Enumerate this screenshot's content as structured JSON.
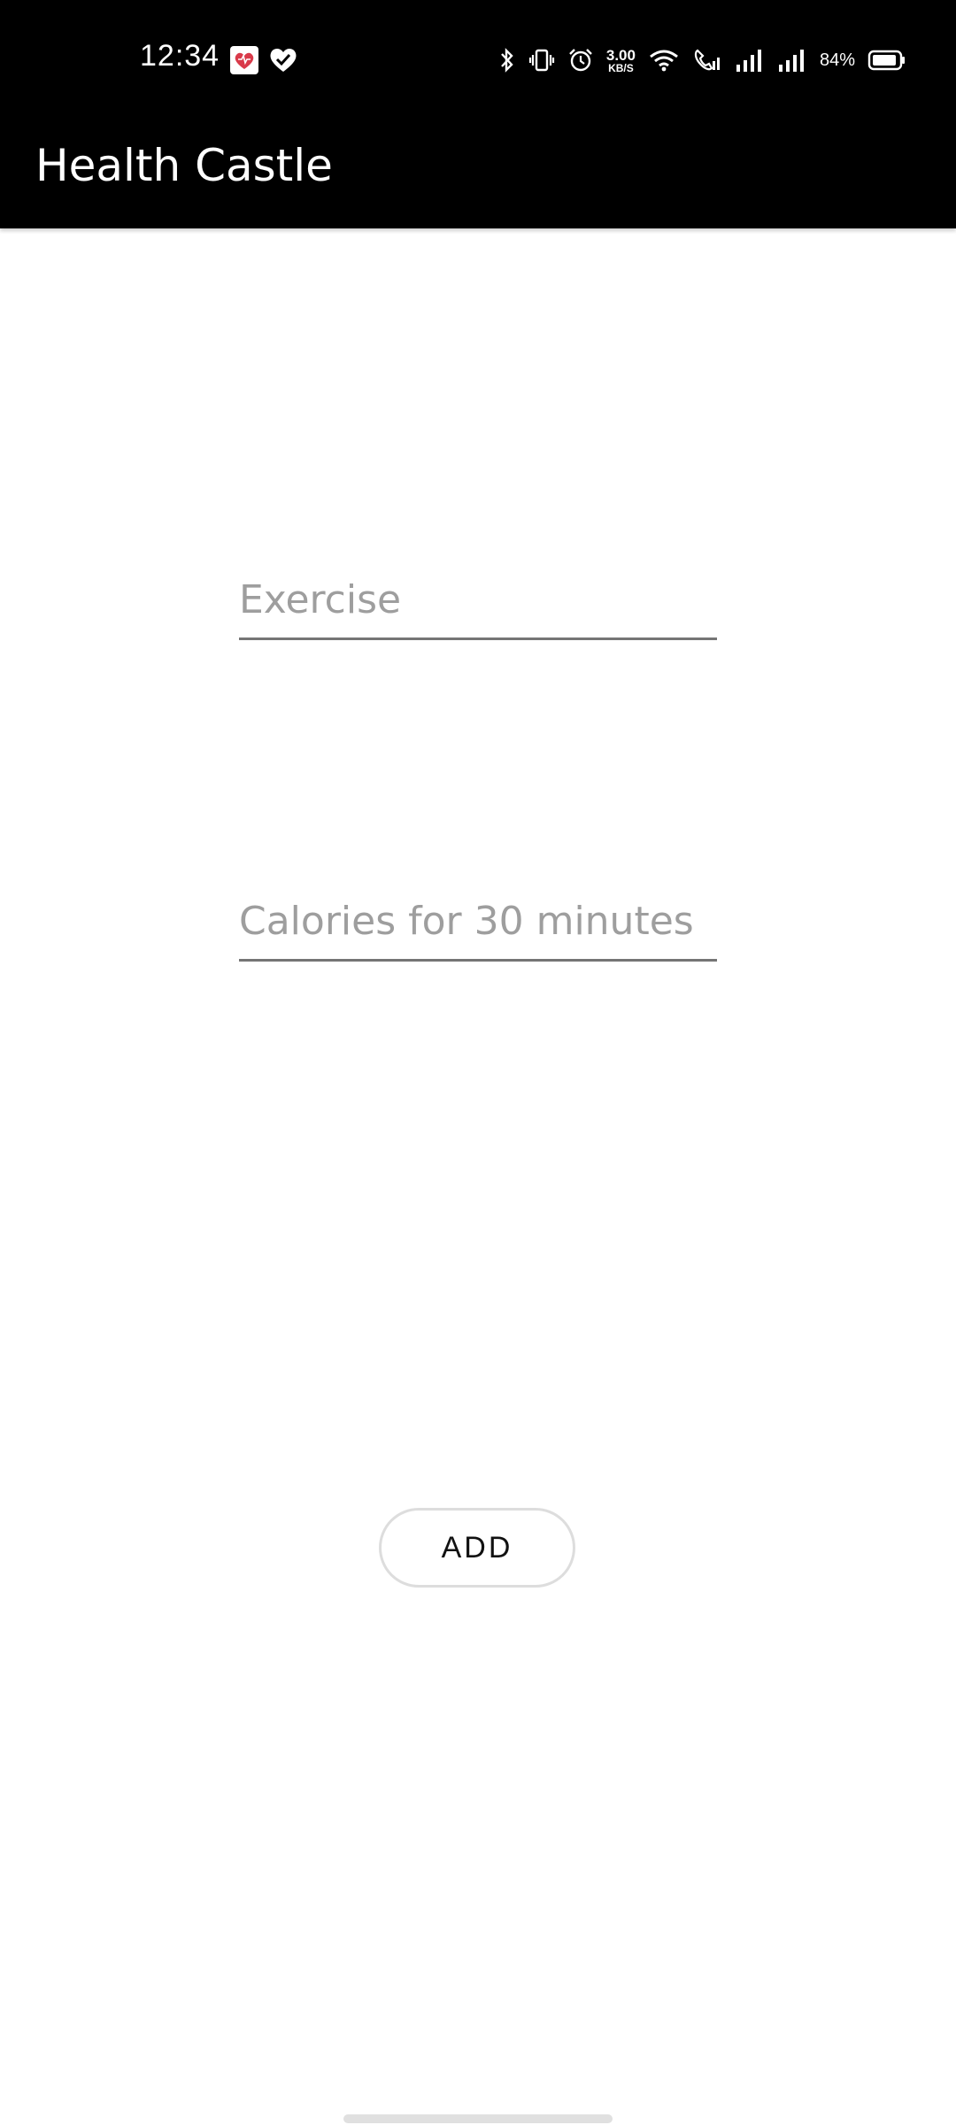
{
  "status_bar": {
    "time": "12:34",
    "net_speed_value": "3.00",
    "net_speed_unit": "KB/S",
    "battery_percent": "84%",
    "icons": [
      "health-app-icon",
      "heart-check-icon",
      "bluetooth-icon",
      "vibrate-icon",
      "alarm-icon",
      "wifi-icon",
      "wifi-call-icon",
      "signal-icon",
      "signal-icon",
      "battery-icon"
    ]
  },
  "app_bar": {
    "title": "Health Castle"
  },
  "form": {
    "exercise_value": "",
    "exercise_placeholder": "Exercise",
    "calories_value": "",
    "calories_placeholder": "Calories for 30 minutes",
    "add_label": "ADD"
  },
  "colors": {
    "app_bar": "#000000",
    "background": "#ffffff",
    "placeholder": "#9e9e9e",
    "underline": "#757575"
  }
}
